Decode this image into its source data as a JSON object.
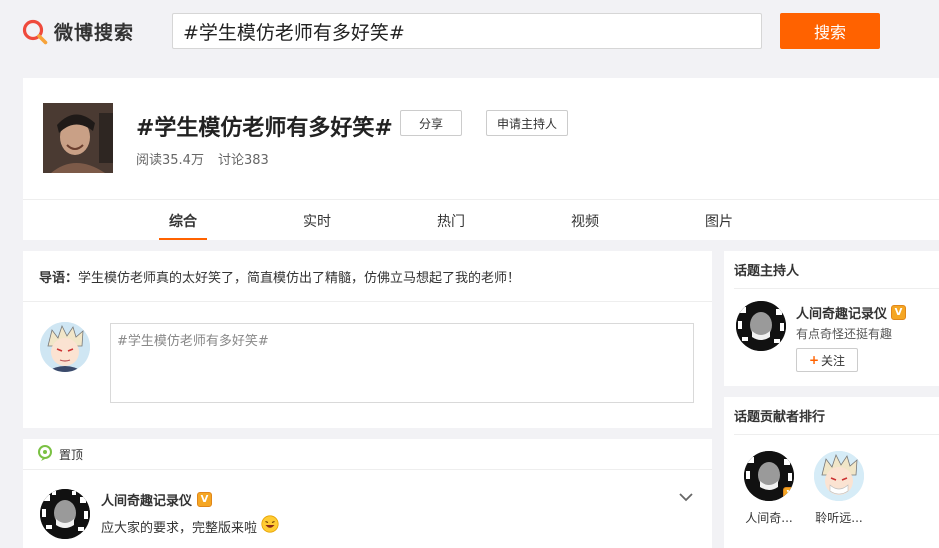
{
  "header": {
    "logo_text": "微博搜索",
    "search_value": "#学生模仿老师有多好笑#",
    "search_button": "搜索"
  },
  "topic": {
    "title": "#学生模仿老师有多好笑#",
    "share_label": "分享",
    "host_apply_label": "申请主持人",
    "reads": "阅读35.4万",
    "discussions": "讨论383",
    "tabs": [
      "综合",
      "实时",
      "热门",
      "视频",
      "图片"
    ],
    "active_tab": "综合"
  },
  "intro": {
    "label": "导语：",
    "text": "学生模仿老师真的太好笑了，简直模仿出了精髓，仿佛立马想起了我的老师！",
    "compose_value": "#学生模仿老师有多好笑#"
  },
  "pinned_post": {
    "pin_label": "置顶",
    "author": "人间奇趣记录仪",
    "verified_badge": "V",
    "text": "应大家的要求，完整版来啦"
  },
  "sidebar": {
    "host_section_title": "话题主持人",
    "host": {
      "name": "人间奇趣记录仪",
      "verified_badge": "V",
      "description": "有点奇怪还挺有趣",
      "follow_label": "关注",
      "follow_plus": "+"
    },
    "contributors_title": "话题贡献者排行",
    "contributors": [
      {
        "name": "人间奇..."
      },
      {
        "name": "聆听远..."
      }
    ]
  },
  "colors": {
    "accent": "#ff6200",
    "background": "#f2f2f5",
    "verified": "#f5a623"
  },
  "icons": {
    "logo": "weibo-search-logo-icon",
    "pin": "pin-icon",
    "chevron": "chevron-down-icon",
    "emoji": "laughing-emoji-icon"
  }
}
